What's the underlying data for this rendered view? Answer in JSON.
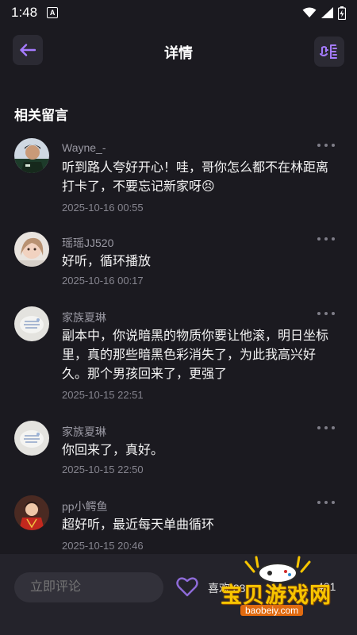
{
  "status_bar": {
    "time": "1:48",
    "sim_label": "A"
  },
  "header": {
    "title": "详情",
    "back_icon": "arrow-left-icon",
    "share_icon": "share-icon",
    "accent_color": "#9a6cff"
  },
  "section": {
    "title": "相关留言"
  },
  "comments": [
    {
      "username": "Wayne_-",
      "text": "听到路人夸好开心！哇，哥你怎么都不在林距离打卡了，不要忘记新家呀😣",
      "time": "2025-10-16 00:55"
    },
    {
      "username": "瑶瑶JJ520",
      "text": "好听，循环播放",
      "time": "2025-10-16 00:17"
    },
    {
      "username": "家族夏琳",
      "text": "副本中，你说暗黑的物质你要让他滚，明日坐标里，真的那些暗黑色彩消失了，为此我高兴好久。那个男孩回来了，更强了",
      "time": "2025-10-15 22:51"
    },
    {
      "username": "家族夏琳",
      "text": "你回来了，真好。",
      "time": "2025-10-15 22:50"
    },
    {
      "username": "pp小鳄鱼",
      "text": "超好听，最近每天单曲循环",
      "time": "2025-10-15 20:46"
    }
  ],
  "bottom_bar": {
    "comment_placeholder": "立即评论",
    "like_label": "喜欢 88",
    "comment_count": "401"
  },
  "watermark": {
    "text": "宝贝游戏网",
    "url": "baobeiy.com"
  }
}
